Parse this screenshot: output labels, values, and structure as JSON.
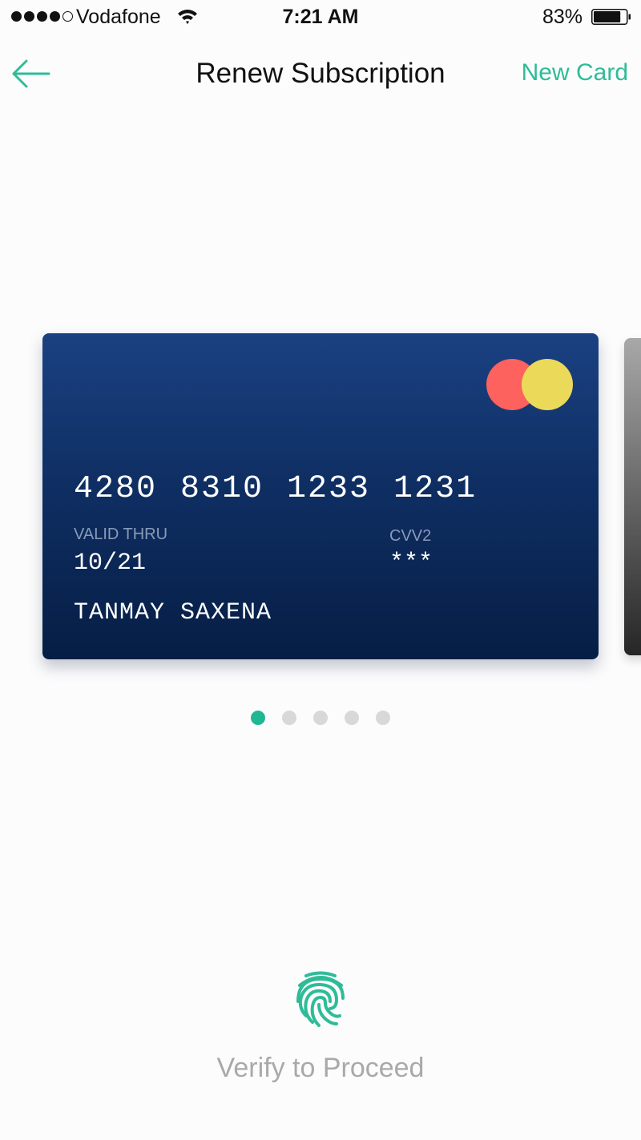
{
  "status_bar": {
    "signal_bars_filled": 4,
    "signal_bars_total": 5,
    "carrier": "Vodafone",
    "wifi_icon": "wifi-icon",
    "time": "7:21 AM",
    "battery_percent": "83%",
    "battery_level": 0.83
  },
  "nav": {
    "back_icon": "arrow-left-icon",
    "title": "Renew Subscription",
    "action_label": "New Card"
  },
  "cards": [
    {
      "number": "4280 8310 1233 1231",
      "valid_label": "VALID THRU",
      "valid_thru": "10/21",
      "cvv_label": "CVV2",
      "cvv": "***",
      "holder": "TANMAY SAXENA",
      "brand_icon": "mastercard-logo-icon"
    }
  ],
  "pager": {
    "count": 5,
    "active_index": 0
  },
  "verify": {
    "icon": "fingerprint-icon",
    "label": "Verify to Proceed"
  },
  "colors": {
    "accent": "#2ebc98",
    "pager_active": "#20b893",
    "pager_inactive": "#d8d8d8",
    "card_top": "#1b4182",
    "card_bottom": "#061e45",
    "logo_red": "#fd625e",
    "logo_yellow": "#ebd95a",
    "verify_text": "#a9a9a9"
  }
}
